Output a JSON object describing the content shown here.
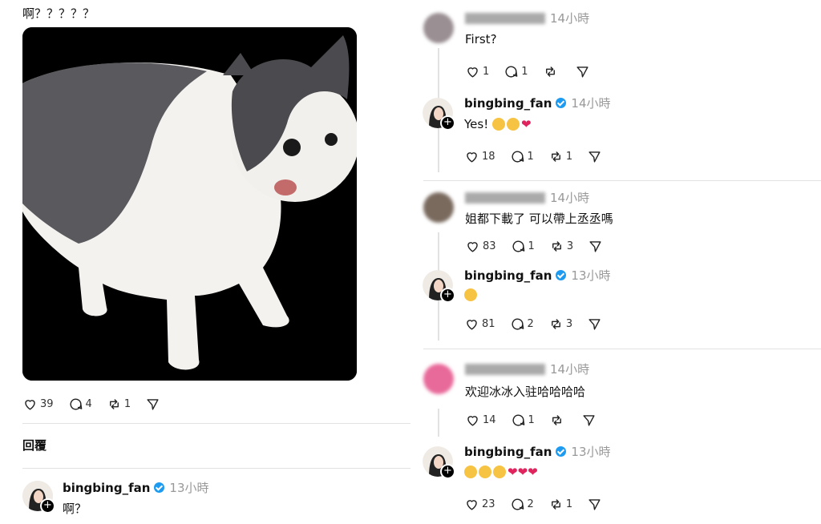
{
  "post": {
    "text": "啊？？？？？",
    "likes": "39",
    "replies": "4",
    "reposts": "1"
  },
  "reply_heading": "回覆",
  "bottom_comment": {
    "username": "bingbing_fan",
    "time": "13小時",
    "text": "啊？"
  },
  "threads": [
    {
      "comment": {
        "username_blurred": true,
        "time": "14小時",
        "text": "First?",
        "likes": "1",
        "replies": "1",
        "reposts": ""
      },
      "reply": {
        "username": "bingbing_fan",
        "time": "14小時",
        "text": "Yes!",
        "emojis": [
          "smile-emoji",
          "pray-emoji",
          "heart-emoji"
        ],
        "likes": "18",
        "replies": "1",
        "reposts": "1"
      }
    },
    {
      "comment": {
        "username_blurred": true,
        "time": "14小時",
        "text": "姐都下載了 可以帶上丞丞嗎",
        "likes": "83",
        "replies": "1",
        "reposts": "3"
      },
      "reply": {
        "username": "bingbing_fan",
        "time": "13小時",
        "text": "",
        "emojis": [
          "thinking-emoji"
        ],
        "likes": "81",
        "replies": "2",
        "reposts": "3"
      }
    },
    {
      "comment": {
        "username_blurred": true,
        "time": "14小時",
        "text": "欢迎冰冰入驻哈哈哈哈",
        "likes": "14",
        "replies": "1",
        "reposts": ""
      },
      "reply": {
        "username": "bingbing_fan",
        "time": "13小時",
        "text": "",
        "emojis": [
          "hugging-emoji",
          "hugging-emoji",
          "hugging-emoji",
          "heart-emoji",
          "heart-emoji",
          "heart-emoji"
        ],
        "likes": "23",
        "replies": "2",
        "reposts": "1"
      }
    }
  ],
  "colors": {
    "verified": "#1d9bf0",
    "heart": "#e0245e",
    "divider": "#e2e2e2"
  }
}
